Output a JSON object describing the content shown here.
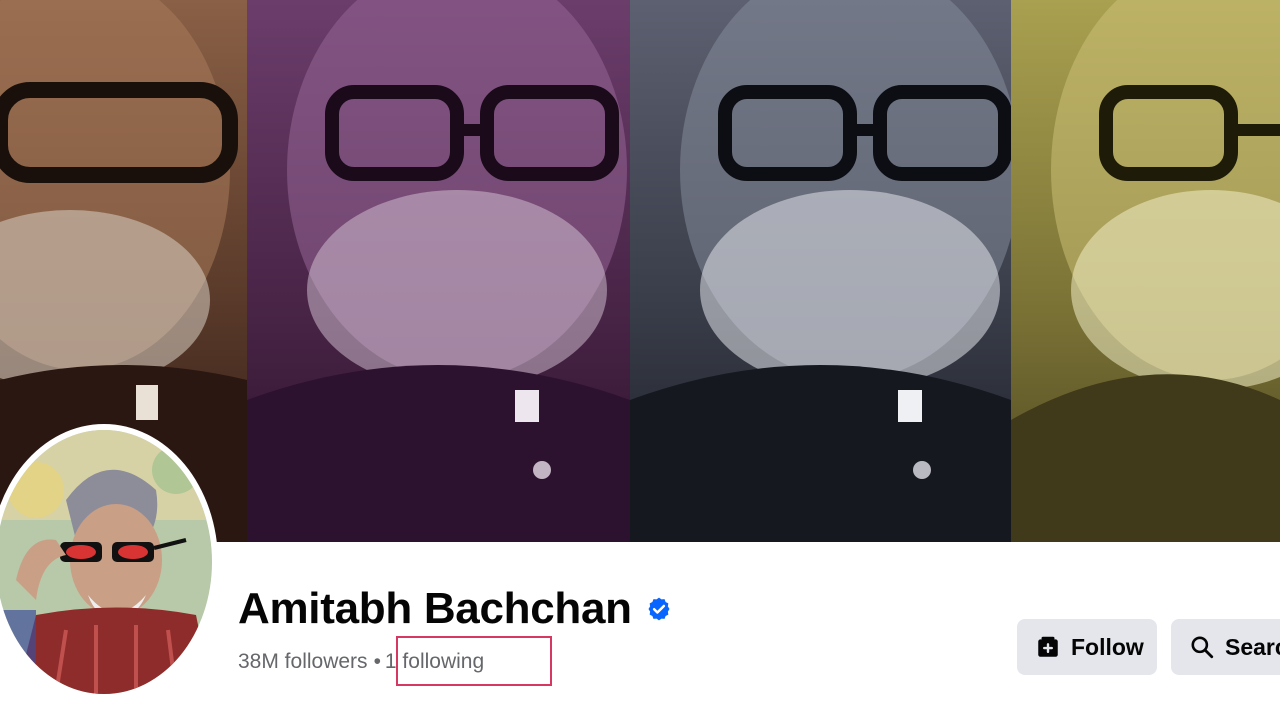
{
  "profile": {
    "name": "Amitabh Bachchan",
    "verified": true,
    "followers_text": "38M followers",
    "separator": "•",
    "following_text": "1 following"
  },
  "actions": {
    "follow_label": "Follow",
    "follow_icon": "follow-page-icon",
    "search_label": "Search",
    "search_icon": "search-icon"
  },
  "cover": {
    "description_panels": [
      "sepia",
      "purple",
      "blue-grey",
      "olive"
    ]
  },
  "colors": {
    "verified_blue": "#0866ff",
    "button_bg": "#e4e6eb",
    "secondary_text": "#65676b",
    "highlight_border": "#d63862"
  }
}
